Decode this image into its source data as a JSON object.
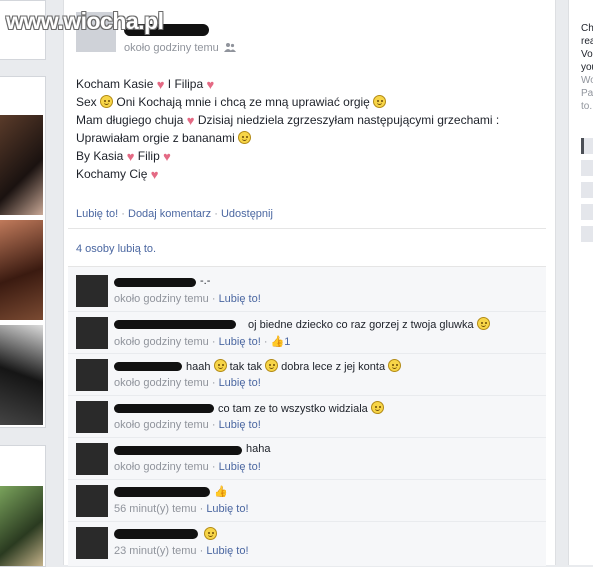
{
  "watermark": "www.wiocha.pl",
  "post": {
    "time": "około godziny temu",
    "lines": [
      [
        "Kocham Kasie",
        "I Filipa"
      ],
      [
        "Sex",
        "Oni Kochają mnie i chcą ze mną uprawiać orgię"
      ],
      [
        "Mam długiego chuja",
        "Dzisiaj niedziela zgrzeszyłam następującymi grzechami :"
      ],
      [
        "Uprawiałam orgie z bananami"
      ],
      [
        "By Kasia",
        "Filip"
      ],
      [
        "Kochamy Cię"
      ]
    ],
    "actions": {
      "like": "Lubię to!",
      "comment": "Dodaj komentarz",
      "share": "Udostępnij",
      "sep": "·"
    },
    "likes_text": "4 osoby lubią to."
  },
  "comments": [
    {
      "text": "-.-",
      "time": "około godziny temu",
      "like": "Lubię to!",
      "likes": ""
    },
    {
      "text": "oj biedne dziecko co raz gorzej z twoja gluwka",
      "time": "około godziny temu",
      "like": "Lubię to!",
      "likes": "1"
    },
    {
      "text": "haah",
      "text2": "tak tak",
      "text3": "dobra lece z jej konta",
      "time": "około godziny temu",
      "like": "Lubię to!",
      "likes": ""
    },
    {
      "text": "co tam ze to wszystko widziala",
      "time": "około godziny temu",
      "like": "Lubię to!",
      "likes": ""
    },
    {
      "text": "haha",
      "time": "około godziny temu",
      "like": "Lubię to!",
      "likes": ""
    },
    {
      "text": "",
      "time": "56 minut(y) temu",
      "like": "Lubię to!",
      "likes": ""
    },
    {
      "text": "",
      "time": "23 minut(y) temu",
      "like": "Lubię to!",
      "likes": ""
    }
  ],
  "right_col": {
    "lines": [
      "Ch",
      "rea",
      "Vol",
      "you",
      "Wo",
      "Pay",
      "to."
    ]
  },
  "icons": {
    "friends": "friends-icon",
    "heart": "heart-icon",
    "smiley": "smiley-icon",
    "thumb": "thumb-up-icon"
  },
  "colors": {
    "link": "#4b67a1",
    "meta": "#90949c",
    "heart": "#e46a84",
    "emoticon": "#f7d548"
  }
}
